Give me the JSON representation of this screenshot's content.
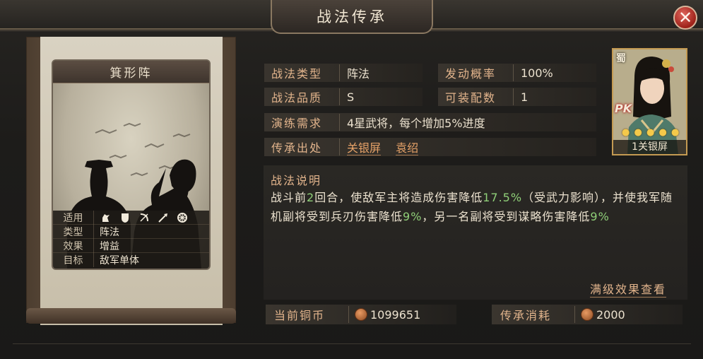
{
  "window": {
    "title": "战法传承",
    "close_label": "✕"
  },
  "card": {
    "name": "箕形阵",
    "rows": [
      {
        "key": "适用",
        "targets": [
          "cavalry-icon",
          "shield-icon",
          "bow-icon",
          "spear-icon",
          "wheel-icon"
        ]
      },
      {
        "key": "类型",
        "value": "阵法"
      },
      {
        "key": "效果",
        "value": "增益"
      },
      {
        "key": "目标",
        "value": "敌军单体"
      }
    ]
  },
  "info": {
    "type_label": "战法类型",
    "type_value": "阵法",
    "prob_label": "发动概率",
    "prob_value": "100%",
    "quality_label": "战法品质",
    "quality_value": "S",
    "slots_label": "可装配数",
    "slots_value": "1",
    "train_label": "演练需求",
    "train_value": "4星武将，每个增加5%进度",
    "source_label": "传承出处",
    "source_links": [
      "关银屏",
      "袁绍"
    ]
  },
  "description": {
    "title": "战法说明",
    "parts": [
      {
        "text": "战斗前",
        "hl": false
      },
      {
        "text": "2",
        "hl": true
      },
      {
        "text": "回合，使敌军主将造成伤害降低",
        "hl": false
      },
      {
        "text": "17.5%",
        "hl": true
      },
      {
        "text": "（受武力影响），并使我军随机副将受到兵刃伤害降低",
        "hl": false
      },
      {
        "text": "9%",
        "hl": true
      },
      {
        "text": "，另一名副将受到谋略伤害降低",
        "hl": false
      },
      {
        "text": "9%",
        "hl": true
      }
    ],
    "full_effect_label": "满级效果查看"
  },
  "costs": {
    "current_label": "当前铜币",
    "current_value": "1099651",
    "cost_label": "传承消耗",
    "cost_value": "2000"
  },
  "portrait": {
    "faction": "蜀",
    "badge": "PK",
    "stars": 5,
    "name": "1关银屏"
  },
  "colors": {
    "accent": "#e2b48c",
    "highlight": "#8fcf78",
    "link": "#e6a268",
    "close_red": "#9d2119"
  }
}
